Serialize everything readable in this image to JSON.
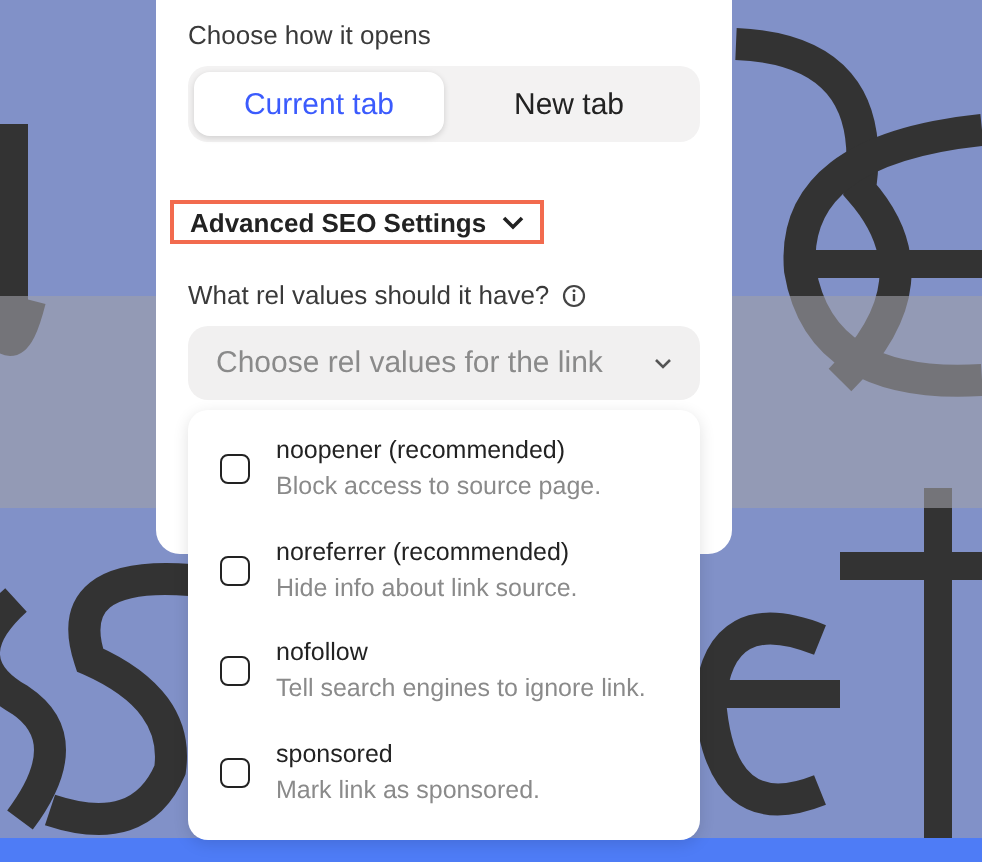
{
  "open_mode": {
    "label": "Choose how it opens",
    "tabs": [
      {
        "label": "Current tab",
        "selected": true
      },
      {
        "label": "New tab",
        "selected": false
      }
    ]
  },
  "seo_toggle": {
    "label": "Advanced SEO Settings",
    "expanded": true
  },
  "rel": {
    "label": "What rel values should it have?",
    "placeholder": "Choose rel values for the link",
    "options": [
      {
        "title": "noopener (recommended)",
        "description": "Block access to source page.",
        "checked": false
      },
      {
        "title": "noreferrer (recommended)",
        "description": "Hide info about link source.",
        "checked": false
      },
      {
        "title": "nofollow",
        "description": "Tell search engines to ignore link.",
        "checked": false
      },
      {
        "title": "sponsored",
        "description": "Mark link as sponsored.",
        "checked": false
      }
    ]
  }
}
